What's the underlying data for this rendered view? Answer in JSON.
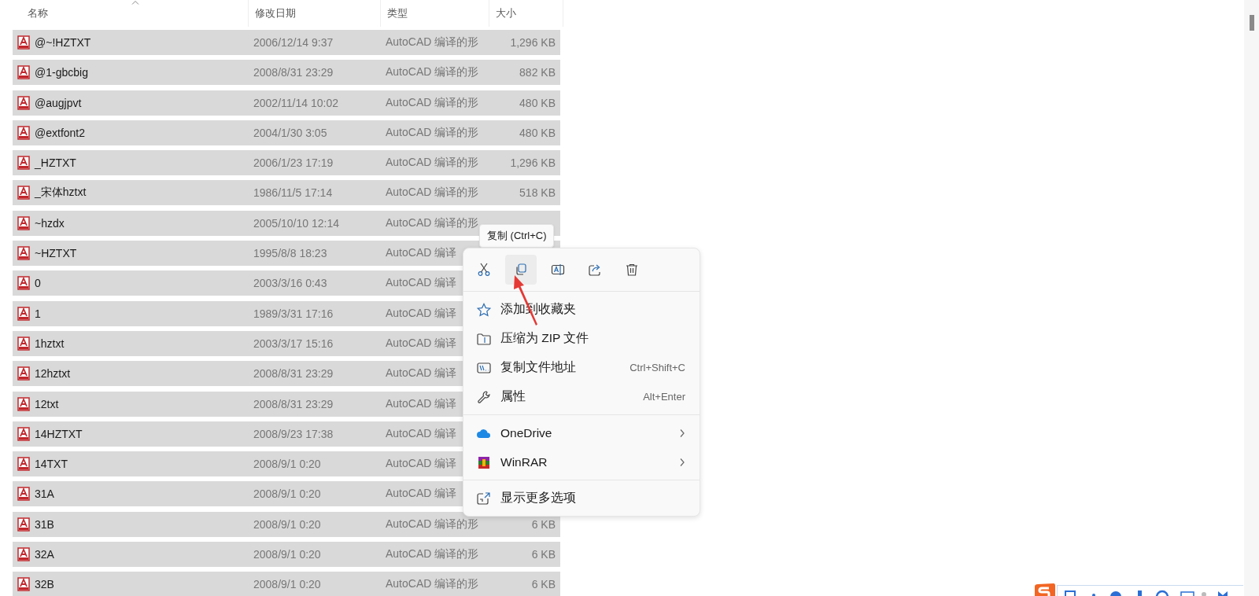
{
  "columns": [
    {
      "label": "名称",
      "sorted": true
    },
    {
      "label": "修改日期",
      "sorted": false
    },
    {
      "label": "类型",
      "sorted": false
    },
    {
      "label": "大小",
      "sorted": false
    }
  ],
  "rows": [
    {
      "name": "@~!HZTXT",
      "date": "2006/12/14 9:37",
      "type": "AutoCAD 编译的形",
      "size": "1,296 KB",
      "selected": true
    },
    {
      "name": "@1-gbcbig",
      "date": "2008/8/31 23:29",
      "type": "AutoCAD 编译的形",
      "size": "882 KB",
      "selected": true
    },
    {
      "name": "@augjpvt",
      "date": "2002/11/14 10:02",
      "type": "AutoCAD 编译的形",
      "size": "480 KB",
      "selected": true
    },
    {
      "name": "@extfont2",
      "date": "2004/1/30 3:05",
      "type": "AutoCAD 编译的形",
      "size": "480 KB",
      "selected": true
    },
    {
      "name": "_HZTXT",
      "date": "2006/1/23 17:19",
      "type": "AutoCAD 编译的形",
      "size": "1,296 KB",
      "selected": true
    },
    {
      "name": "_宋体hztxt",
      "date": "1986/11/5 17:14",
      "type": "AutoCAD 编译的形",
      "size": "518 KB",
      "selected": true
    },
    {
      "name": "~hzdx",
      "date": "2005/10/10 12:14",
      "type": "AutoCAD 编译的形",
      "selected": true
    },
    {
      "name": "~HZTXT",
      "date": "1995/8/8 18:23",
      "type": "AutoCAD 编译",
      "selected": true
    },
    {
      "name": "0",
      "date": "2003/3/16 0:43",
      "type": "AutoCAD 编译",
      "selected": true
    },
    {
      "name": "1",
      "date": "1989/3/31 17:16",
      "type": "AutoCAD 编译",
      "selected": true
    },
    {
      "name": "1hztxt",
      "date": "2003/3/17 15:16",
      "type": "AutoCAD 编译",
      "selected": true
    },
    {
      "name": "12hztxt",
      "date": "2008/8/31 23:29",
      "type": "AutoCAD 编译",
      "selected": true
    },
    {
      "name": "12txt",
      "date": "2008/8/31 23:29",
      "type": "AutoCAD 编译",
      "selected": true
    },
    {
      "name": "14HZTXT",
      "date": "2008/9/23 17:38",
      "type": "AutoCAD 编译",
      "selected": true
    },
    {
      "name": "14TXT",
      "date": "2008/9/1 0:20",
      "type": "AutoCAD 编译",
      "selected": true
    },
    {
      "name": "31A",
      "date": "2008/9/1 0:20",
      "type": "AutoCAD 编译",
      "selected": true
    },
    {
      "name": "31B",
      "date": "2008/9/1 0:20",
      "type": "AutoCAD 编译的形",
      "size": "6 KB",
      "selected": true
    },
    {
      "name": "32A",
      "date": "2008/9/1 0:20",
      "type": "AutoCAD 编译的形",
      "size": "6 KB",
      "selected": true
    },
    {
      "name": "32B",
      "date": "2008/9/1 0:20",
      "type": "AutoCAD 编译的形",
      "size": "6 KB",
      "selected": true
    }
  ],
  "tooltip": "复制 (Ctrl+C)",
  "context_menu": {
    "toolbar": [
      {
        "kind": "cut",
        "selected": false
      },
      {
        "kind": "copy",
        "selected": true
      },
      {
        "kind": "rename",
        "selected": false
      },
      {
        "kind": "share",
        "selected": false
      },
      {
        "kind": "delete",
        "selected": false
      }
    ],
    "groups": [
      [
        {
          "kind": "favorite",
          "label": "添加到收藏夹"
        },
        {
          "kind": "zip",
          "label": "压缩为 ZIP 文件"
        },
        {
          "kind": "path",
          "label": "复制文件地址",
          "shortcut": "Ctrl+Shift+C"
        },
        {
          "kind": "properties",
          "label": "属性",
          "shortcut": "Alt+Enter"
        }
      ],
      [
        {
          "kind": "onedrive",
          "label": "OneDrive",
          "submenu": true
        },
        {
          "kind": "winrar",
          "label": "WinRAR",
          "submenu": true
        }
      ],
      [
        {
          "kind": "more",
          "label": "显示更多选项"
        }
      ]
    ]
  }
}
